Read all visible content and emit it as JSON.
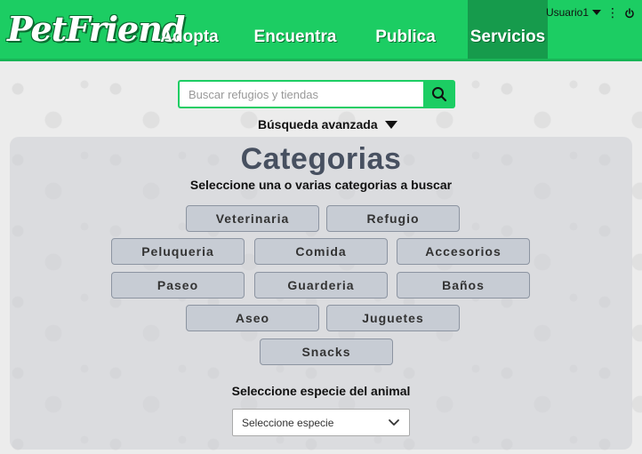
{
  "header": {
    "logo": "PetFriend",
    "nav": [
      {
        "label": "Adopta"
      },
      {
        "label": "Encuentra"
      },
      {
        "label": "Publica"
      },
      {
        "label": "Servicios"
      }
    ],
    "user": "Usuario1"
  },
  "search": {
    "placeholder": "Buscar refugios y tiendas",
    "advanced_label": "Búsqueda avanzada"
  },
  "categories": {
    "title": "Categorias",
    "subtitle": "Seleccione una o varias categorias a buscar",
    "items": [
      "Veterinaria",
      "Refugio",
      "Peluqueria",
      "Comida",
      "Accesorios",
      "Paseo",
      "Guarderia",
      "Baños",
      "Aseo",
      "Juguetes",
      "Snacks"
    ]
  },
  "species": {
    "label": "Seleccione especie del animal",
    "selected": "Seleccione especie"
  },
  "colors": {
    "accent": "#1ccd63",
    "active_nav": "#169b4c",
    "category_button": "#c7ccd4",
    "title": "#475060"
  },
  "icons": {
    "search": "search-icon",
    "dropdown": "chevron-down-icon",
    "user_menu": "caret-down-icon",
    "more": "kebab-icon",
    "logout": "power-icon"
  }
}
